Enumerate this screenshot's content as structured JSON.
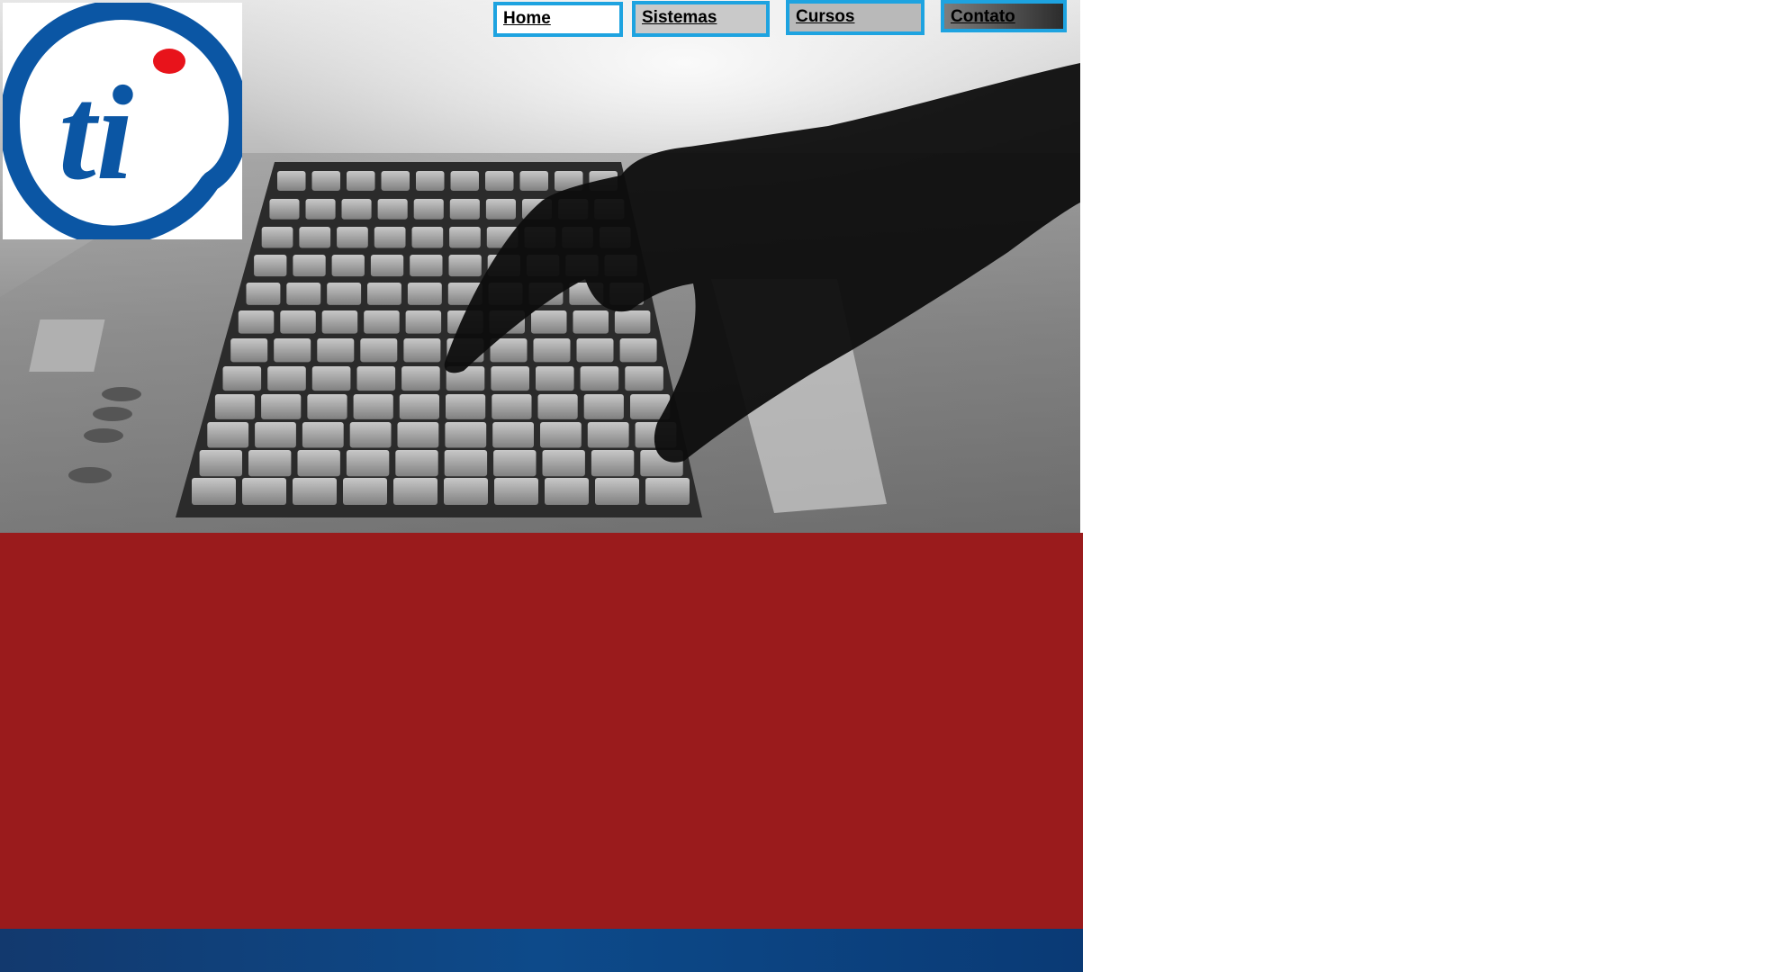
{
  "header": {
    "logo_text": "ti",
    "nav": [
      {
        "label": "Home"
      },
      {
        "label": "Sistemas"
      },
      {
        "label": "Cursos"
      },
      {
        "label": "Contato"
      }
    ]
  },
  "colors": {
    "nav_border": "#1ea3e0",
    "logo_blue": "#0b56a4",
    "logo_dot": "#e8131b",
    "red_band": "#9a1b1c",
    "blue_band": "#0d4a8a"
  },
  "hero": {
    "image": "laptop-keyboard-hand-photo"
  }
}
